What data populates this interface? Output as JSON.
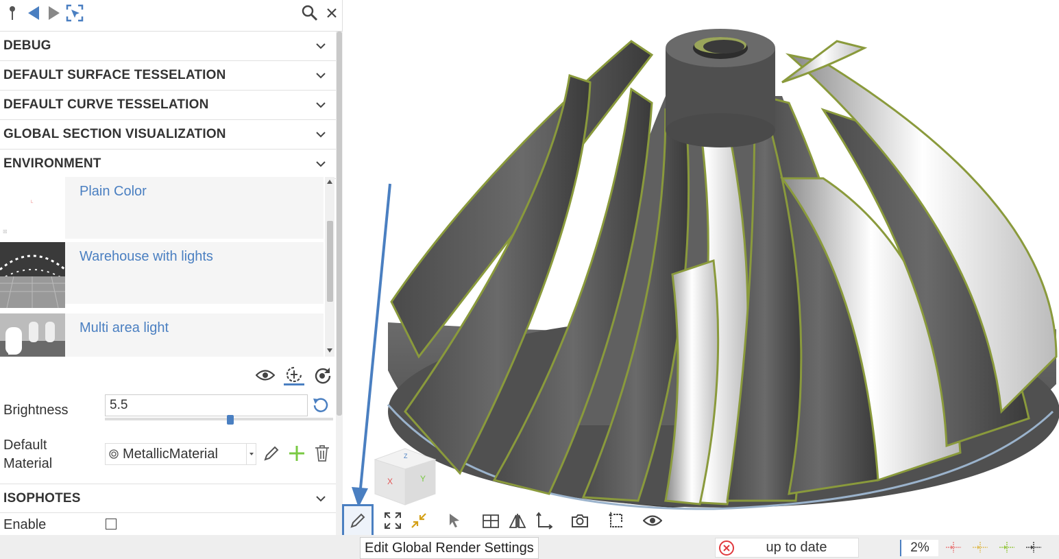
{
  "sections": {
    "debug": "DEBUG",
    "surface_tesselation": "DEFAULT SURFACE TESSELATION",
    "curve_tesselation": "DEFAULT CURVE TESSELATION",
    "section_visualization": "GLOBAL SECTION VISUALIZATION",
    "environment": "ENVIRONMENT",
    "isophotes": "ISOPHOTES"
  },
  "environment": {
    "items": [
      {
        "label": "Plain Color"
      },
      {
        "label": "Warehouse with lights"
      },
      {
        "label": "Multi area light"
      }
    ]
  },
  "properties": {
    "brightness_label": "Brightness",
    "brightness_value": "5.5",
    "brightness_slider_fraction": 0.55,
    "material_label_line1": "Default",
    "material_label_line2": "Material",
    "material_value": "MetallicMaterial",
    "isophotes_enable_label": "Enable"
  },
  "tooltip": "Edit Global Render Settings",
  "status": {
    "text": "up to date",
    "zoom": "2%"
  },
  "colors": {
    "accent": "#4a7fc1",
    "link": "#4a7fc1",
    "error": "#e0393e",
    "add": "#7ac943"
  }
}
